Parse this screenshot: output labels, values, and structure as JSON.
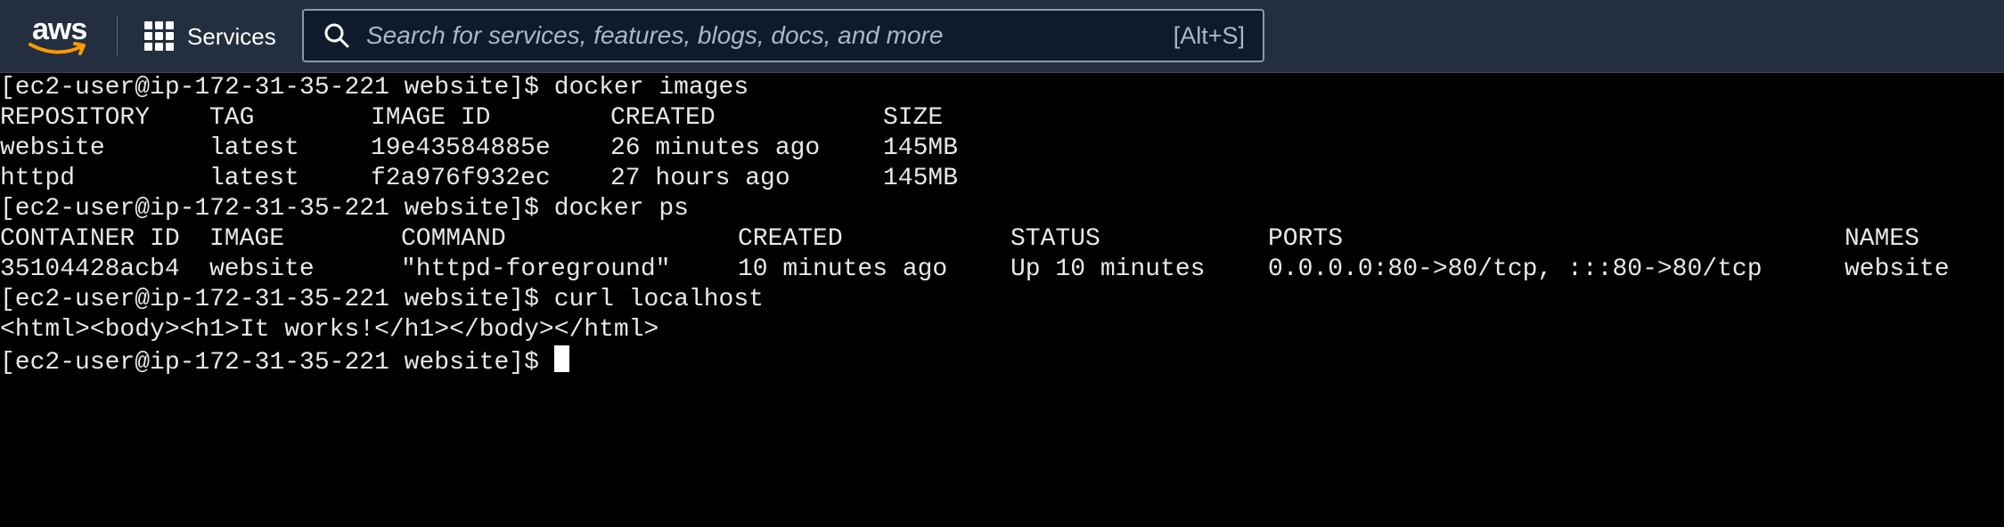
{
  "header": {
    "logo_text": "aws",
    "services_label": "Services",
    "search_placeholder": "Search for services, features, blogs, docs, and more",
    "search_shortcut": "[Alt+S]"
  },
  "terminal": {
    "prompt1": "[ec2-user@ip-172-31-35-221 website]$ docker images",
    "images_headers": [
      "REPOSITORY",
      "TAG",
      "IMAGE ID",
      "CREATED",
      "SIZE"
    ],
    "images_rows": [
      [
        "website",
        "latest",
        "19e43584885e",
        "26 minutes ago",
        "145MB"
      ],
      [
        "httpd",
        "latest",
        "f2a976f932ec",
        "27 hours ago",
        "145MB"
      ]
    ],
    "prompt2": "[ec2-user@ip-172-31-35-221 website]$ docker ps",
    "ps_headers": [
      "CONTAINER ID",
      "IMAGE",
      "COMMAND",
      "CREATED",
      "STATUS",
      "PORTS",
      "NAMES"
    ],
    "ps_row": [
      "35104428acb4",
      "website",
      "\"httpd-foreground\"",
      "10 minutes ago",
      "Up 10 minutes",
      "0.0.0.0:80->80/tcp, :::80->80/tcp",
      "website"
    ],
    "prompt3": "[ec2-user@ip-172-31-35-221 website]$ curl localhost",
    "curl_output": "<html><body><h1>It works!</h1></body></html>",
    "prompt4": "[ec2-user@ip-172-31-35-221 website]$ "
  },
  "colors": {
    "header_bg": "#232f3e",
    "terminal_bg": "#000000",
    "terminal_text": "#e8e8e8",
    "aws_smile": "#ff9900"
  }
}
